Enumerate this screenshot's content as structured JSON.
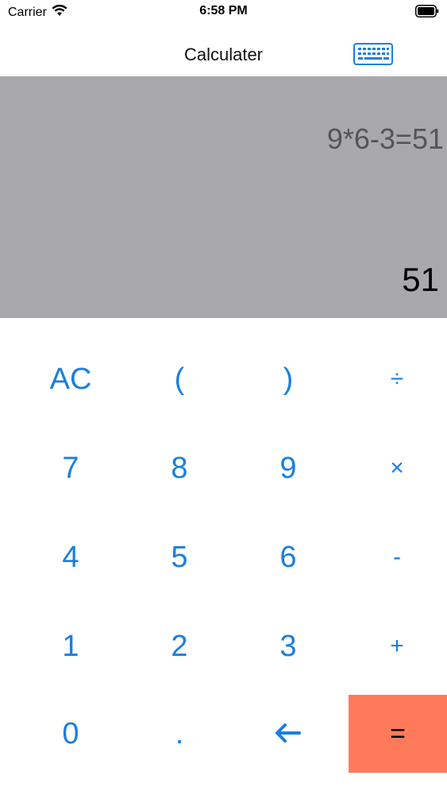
{
  "status_bar": {
    "carrier": "Carrier",
    "time": "6:58 PM"
  },
  "nav": {
    "title": "Calculater"
  },
  "display": {
    "expression": "9*6-3=51",
    "result": "51"
  },
  "keys": {
    "ac": "AC",
    "open_paren": "(",
    "close_paren": ")",
    "divide": "÷",
    "seven": "7",
    "eight": "8",
    "nine": "9",
    "multiply": "×",
    "four": "4",
    "five": "5",
    "six": "6",
    "minus": "-",
    "one": "1",
    "two": "2",
    "three": "3",
    "plus": "+",
    "zero": "0",
    "dot": ".",
    "equals": "="
  },
  "colors": {
    "accent": "#1a7fe0",
    "display_bg": "#a9a8aa",
    "equals_bg": "#ff7a5a"
  },
  "icons": {
    "wifi": "wifi-icon",
    "battery": "battery-icon",
    "keyboard": "keyboard-icon",
    "backspace": "arrow-left-icon"
  }
}
